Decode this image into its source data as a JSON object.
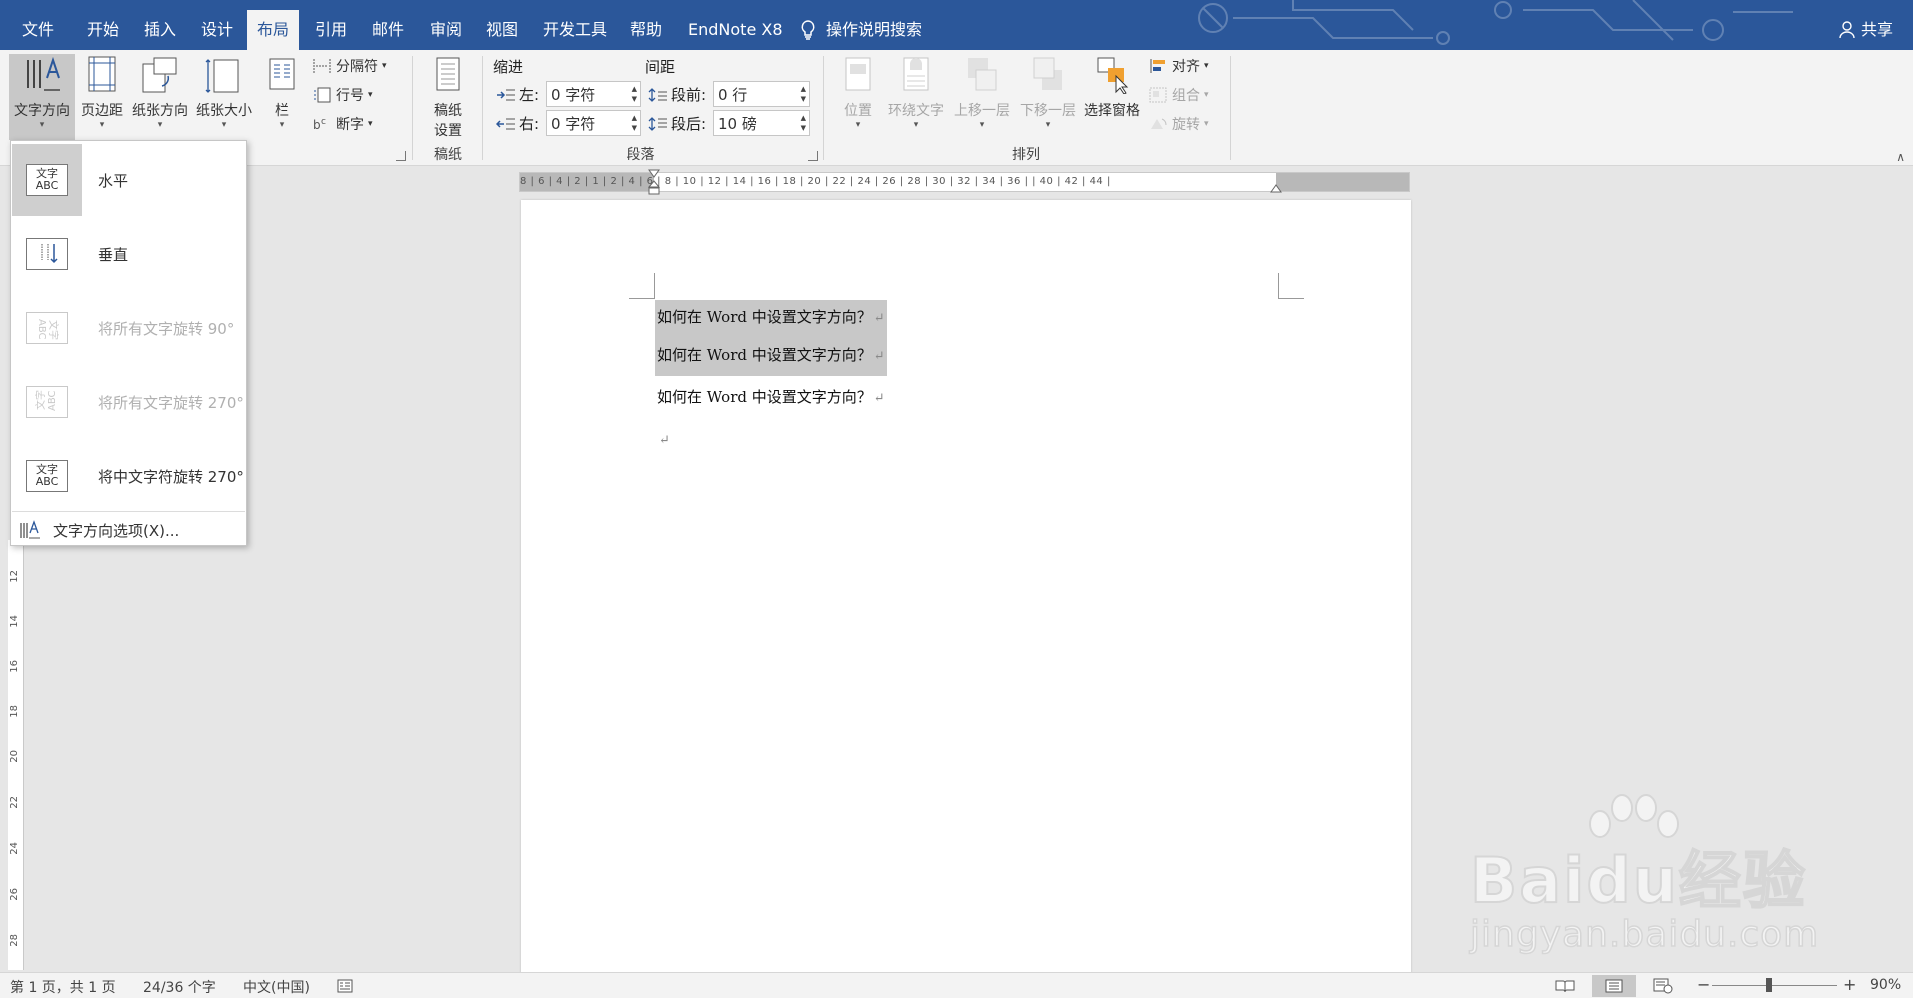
{
  "tabs": [
    {
      "label": "文件"
    },
    {
      "label": "开始"
    },
    {
      "label": "插入"
    },
    {
      "label": "设计"
    },
    {
      "label": "布局"
    },
    {
      "label": "引用"
    },
    {
      "label": "邮件"
    },
    {
      "label": "审阅"
    },
    {
      "label": "视图"
    },
    {
      "label": "开发工具"
    },
    {
      "label": "帮助"
    },
    {
      "label": "EndNote X8"
    }
  ],
  "search_label": "操作说明搜索",
  "share_label": "共享",
  "ribbon": {
    "page_setup": {
      "text_direction": "文字方向",
      "margins": "页边距",
      "orientation": "纸张方向",
      "size": "纸张大小",
      "columns": "栏",
      "breaks": "分隔符",
      "line_numbers": "行号",
      "hyphenation": "断字"
    },
    "manuscript": {
      "button": "稿纸\n设置",
      "line1": "稿纸",
      "line2": "设置",
      "group": "稿纸"
    },
    "paragraph": {
      "indent_label": "缩进",
      "spacing_label": "间距",
      "left_label": "左:",
      "right_label": "右:",
      "left_value": "0 字符",
      "right_value": "0 字符",
      "before_label": "段前:",
      "after_label": "段后:",
      "before_value": "0 行",
      "after_value": "10 磅",
      "group": "段落"
    },
    "arrange": {
      "position": "位置",
      "wrap_text": "环绕文字",
      "bring_forward": "上移一层",
      "send_backward": "下移一层",
      "selection_pane": "选择窗格",
      "align": "对齐",
      "group_objects": "组合",
      "rotate": "旋转",
      "group": "排列"
    }
  },
  "dropdown": {
    "items": [
      {
        "label": "水平",
        "thumb_top": "文字",
        "thumb_bottom": "ABC"
      },
      {
        "label": "垂直"
      },
      {
        "label": "将所有文字旋转 90°"
      },
      {
        "label": "将所有文字旋转 270°"
      },
      {
        "label": "将中文字符旋转 270°",
        "thumb_top": "文字",
        "thumb_bottom": "ABC"
      }
    ],
    "options_label": "文字方向选项(X)..."
  },
  "ruler": {
    "h_ticks": "8 | 6 | 4 | 2 | 1 | 2 | 4 | 6 | 8 | 10 | 12 | 14 | 16 | 18 | 20 | 22 | 24 | 26 | 28 | 30 | 32 | 34 | 36 | | 40 | 42 | 44 |",
    "v_ticks": [
      "12",
      "14",
      "16",
      "18",
      "20",
      "22",
      "24",
      "26",
      "28"
    ]
  },
  "document": {
    "paragraphs": [
      {
        "text": "如何在 Word 中设置文字方向？",
        "highlighted": true
      },
      {
        "text": "如何在 Word 中设置文字方向？",
        "highlighted": true
      },
      {
        "text": "如何在 Word 中设置文字方向？",
        "highlighted": false
      }
    ],
    "para_mark": "↵"
  },
  "status": {
    "page": "第 1 页，共 1 页",
    "words": "24/36 个字",
    "language": "中文(中国)",
    "zoom": "90%",
    "zoom_out": "−",
    "zoom_in": "+"
  },
  "watermark": {
    "line1": "Baidu经验",
    "line2": "jingyan.baidu.com"
  },
  "colors": {
    "title_bar": "#2b579a",
    "ribbon": "#f3f3f3",
    "selection": "#c8c8c8",
    "canvas": "#e6e6e6"
  }
}
